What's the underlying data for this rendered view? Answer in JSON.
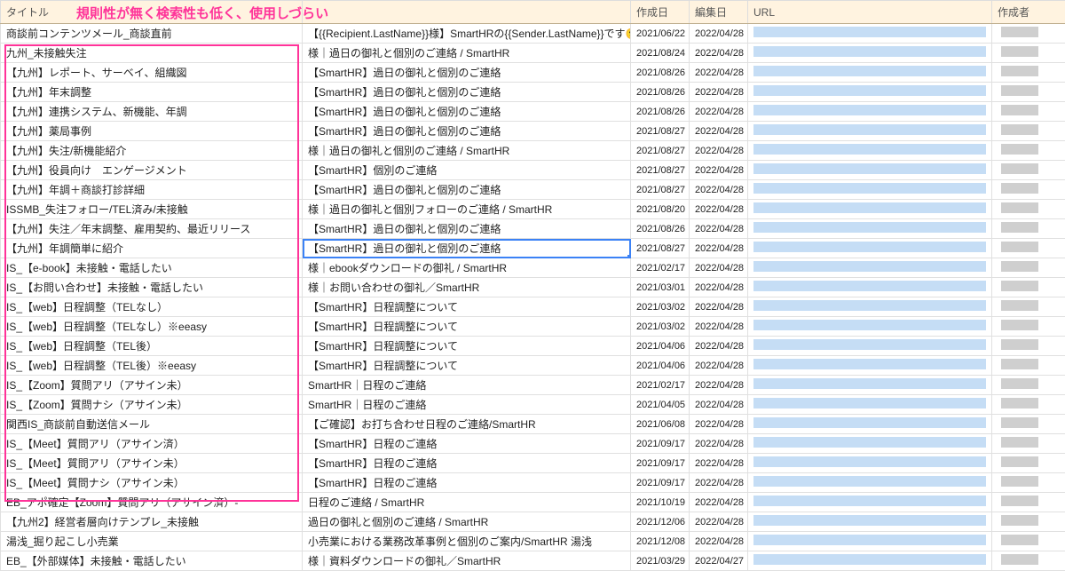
{
  "annotation": "規則性が無く検索性も低く、使用しづらい",
  "headers": {
    "title": "タイトル",
    "subject": "",
    "created": "作成日",
    "edited": "編集日",
    "url": "URL",
    "author": "作成者"
  },
  "rows": [
    {
      "title": "商談前コンテンツメール_商談直前",
      "subject": "【{{Recipient.LastName}}様】SmartHRの{{Sender.LastName}}です🙂",
      "created": "2021/06/22",
      "edited": "2022/04/28"
    },
    {
      "title": "九州_未接触失注",
      "subject": "様｜過日の御礼と個別のご連絡 / SmartHR",
      "created": "2021/08/24",
      "edited": "2022/04/28"
    },
    {
      "title": "【九州】レポート、サーベイ、組織図",
      "subject": "【SmartHR】過日の御礼と個別のご連絡",
      "created": "2021/08/26",
      "edited": "2022/04/28"
    },
    {
      "title": "【九州】年末調整",
      "subject": "【SmartHR】過日の御礼と個別のご連絡",
      "created": "2021/08/26",
      "edited": "2022/04/28"
    },
    {
      "title": "【九州】連携システム、新機能、年調",
      "subject": "【SmartHR】過日の御礼と個別のご連絡",
      "created": "2021/08/26",
      "edited": "2022/04/28"
    },
    {
      "title": "【九州】薬局事例",
      "subject": "【SmartHR】過日の御礼と個別のご連絡",
      "created": "2021/08/27",
      "edited": "2022/04/28"
    },
    {
      "title": "【九州】失注/新機能紹介",
      "subject": "様｜過日の御礼と個別のご連絡 / SmartHR",
      "created": "2021/08/27",
      "edited": "2022/04/28"
    },
    {
      "title": "【九州】役員向け　エンゲージメント",
      "subject": "【SmartHR】個別のご連絡",
      "created": "2021/08/27",
      "edited": "2022/04/28"
    },
    {
      "title": "【九州】年調＋商談打診詳細",
      "subject": "【SmartHR】過日の御礼と個別のご連絡",
      "created": "2021/08/27",
      "edited": "2022/04/28"
    },
    {
      "title": "ISSMB_失注フォロー/TEL済み/未接触",
      "subject": "様｜過日の御礼と個別フォローのご連絡 / SmartHR",
      "created": "2021/08/20",
      "edited": "2022/04/28"
    },
    {
      "title": "【九州】失注／年末調整、雇用契約、最近リリース",
      "subject": "【SmartHR】過日の御礼と個別のご連絡",
      "created": "2021/08/26",
      "edited": "2022/04/28"
    },
    {
      "title": "【九州】年調簡単に紹介",
      "subject_selected": true,
      "subject": "【SmartHR】過日の御礼と個別のご連絡",
      "created": "2021/08/27",
      "edited": "2022/04/28"
    },
    {
      "title": "IS_【e-book】未接触・電話したい",
      "subject": "様｜ebookダウンロードの御礼 / SmartHR",
      "created": "2021/02/17",
      "edited": "2022/04/28"
    },
    {
      "title": "IS_【お問い合わせ】未接触・電話したい",
      "subject": "様｜お問い合わせの御礼／SmartHR",
      "created": "2021/03/01",
      "edited": "2022/04/28"
    },
    {
      "title": "IS_【web】日程調整（TELなし）",
      "subject": "【SmartHR】日程調整について",
      "created": "2021/03/02",
      "edited": "2022/04/28"
    },
    {
      "title": "IS_【web】日程調整（TELなし）※eeasy",
      "subject": "【SmartHR】日程調整について",
      "created": "2021/03/02",
      "edited": "2022/04/28"
    },
    {
      "title": "IS_【web】日程調整（TEL後）",
      "subject": "【SmartHR】日程調整について",
      "created": "2021/04/06",
      "edited": "2022/04/28"
    },
    {
      "title": "IS_【web】日程調整（TEL後）※eeasy",
      "subject": "【SmartHR】日程調整について",
      "created": "2021/04/06",
      "edited": "2022/04/28"
    },
    {
      "title": "IS_【Zoom】質問アリ（アサイン未）",
      "subject": "SmartHR｜日程のご連絡",
      "created": "2021/02/17",
      "edited": "2022/04/28"
    },
    {
      "title": "IS_【Zoom】質問ナシ（アサイン未）",
      "subject": "SmartHR｜日程のご連絡",
      "created": "2021/04/05",
      "edited": "2022/04/28"
    },
    {
      "title": "関西IS_商談前自動送信メール",
      "subject": "【ご確認】お打ち合わせ日程のご連絡/SmartHR",
      "created": "2021/06/08",
      "edited": "2022/04/28"
    },
    {
      "title": "IS_【Meet】質問アリ（アサイン済）",
      "subject": "【SmartHR】日程のご連絡",
      "created": "2021/09/17",
      "edited": "2022/04/28"
    },
    {
      "title": "IS_【Meet】質問アリ（アサイン未）",
      "subject": "【SmartHR】日程のご連絡",
      "created": "2021/09/17",
      "edited": "2022/04/28"
    },
    {
      "title": "IS_【Meet】質問ナシ（アサイン未）",
      "subject": "【SmartHR】日程のご連絡",
      "created": "2021/09/17",
      "edited": "2022/04/28"
    },
    {
      "title": "EB_アポ確定【Zoom】質問アリ（アサイン済）‐",
      "subject": "日程のご連絡 / SmartHR",
      "created": "2021/10/19",
      "edited": "2022/04/28"
    },
    {
      "title": "【九州2】経営者層向けテンプレ_未接触",
      "subject": "過日の御礼と個別のご連絡 / SmartHR",
      "created": "2021/12/06",
      "edited": "2022/04/28"
    },
    {
      "title": "湯浅_掘り起こし小売業",
      "subject": "小売業における業務改革事例と個別のご案内/SmartHR 湯浅",
      "created": "2021/12/08",
      "edited": "2022/04/28"
    },
    {
      "title": "EB_【外部媒体】未接触・電話したい",
      "subject": "様｜資料ダウンロードの御礼／SmartHR",
      "created": "2021/03/29",
      "edited": "2022/04/27"
    }
  ]
}
